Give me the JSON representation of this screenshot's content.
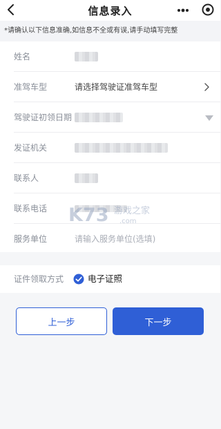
{
  "header": {
    "title": "信息录入"
  },
  "notice": "*请确认以下信息准确,如信息不全或有误,请手动填写完整",
  "form": {
    "fields": [
      {
        "label": "姓名"
      },
      {
        "label": "准驾车型",
        "placeholder": "请选择驾驶证准驾车型"
      },
      {
        "label": "驾驶证初领日期"
      },
      {
        "label": "发证机关"
      },
      {
        "label": "联系人"
      },
      {
        "label": "联系电话"
      },
      {
        "label": "服务单位",
        "placeholder": "请输入服务单位(选填)"
      }
    ]
  },
  "pickup": {
    "label": "证件领取方式",
    "option": "电子证照",
    "checked": true
  },
  "buttons": {
    "prev": "上一步",
    "next": "下一步"
  },
  "watermark": {
    "logo": "K73",
    "text": "游戏之家",
    "url": ".com"
  },
  "colors": {
    "accent": "#2f5fd6",
    "label": "#8a8f99",
    "placeholder": "#a9adb6",
    "background": "#f5f6f8"
  }
}
